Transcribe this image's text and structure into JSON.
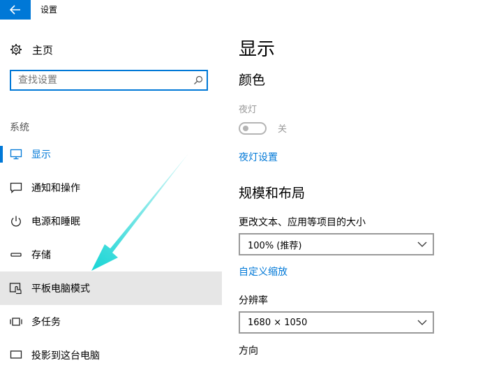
{
  "window": {
    "title": "设置"
  },
  "sidebar": {
    "home_label": "主页",
    "search_placeholder": "查找设置",
    "section_label": "系统",
    "items": [
      {
        "label": "显示",
        "icon": "monitor-icon",
        "state": "active"
      },
      {
        "label": "通知和操作",
        "icon": "notification-icon"
      },
      {
        "label": "电源和睡眠",
        "icon": "power-icon"
      },
      {
        "label": "存储",
        "icon": "storage-icon"
      },
      {
        "label": "平板电脑模式",
        "icon": "tablet-mode-icon",
        "state": "hover"
      },
      {
        "label": "多任务",
        "icon": "multitask-icon"
      },
      {
        "label": "投影到这台电脑",
        "icon": "projecting-icon"
      }
    ]
  },
  "main": {
    "title": "显示",
    "color_heading": "颜色",
    "night_light": {
      "label": "夜灯",
      "toggle_state": "关",
      "on": false
    },
    "night_light_settings_link": "夜灯设置",
    "scale_heading": "规模和布局",
    "scale_label": "更改文本、应用等项目的大小",
    "scale_value": "100% (推荐)",
    "custom_scaling_link": "自定义缩放",
    "resolution_label": "分辨率",
    "resolution_value": "1680 × 1050",
    "orientation_label": "方向"
  },
  "colors": {
    "accent": "#0078d7",
    "hover_bg": "#e6e6e6",
    "annotation_arrow": "#1fd6d6"
  }
}
